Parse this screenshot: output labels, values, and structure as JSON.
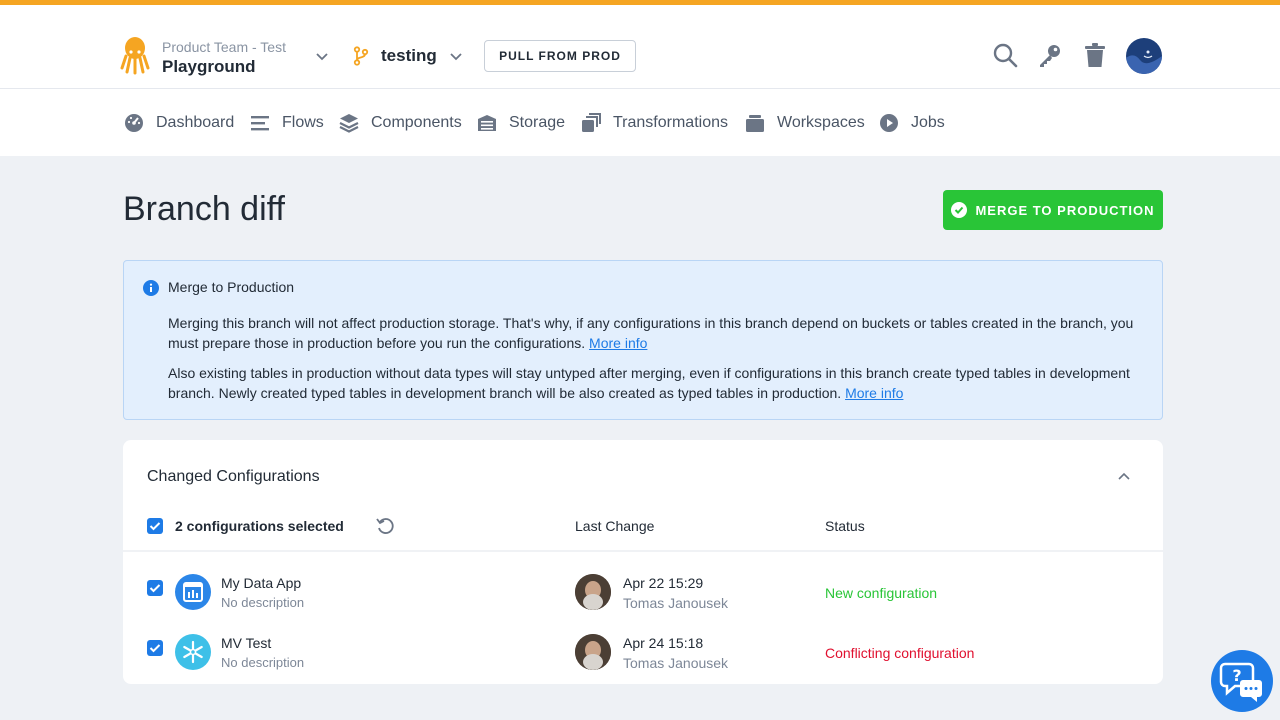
{
  "colors": {
    "accent_bar": "#f5a522",
    "primary": "#1e7be6",
    "success": "#29c537",
    "danger": "#e0102f",
    "status_new": "#29c537",
    "status_conflict": "#e0102f"
  },
  "header": {
    "org": "Product Team - Test",
    "project": "Playground",
    "branch": "testing",
    "pull_button": "PULL FROM PROD",
    "icons": [
      "search-icon",
      "key-icon",
      "trash-icon"
    ]
  },
  "nav": {
    "items": [
      {
        "label": "Dashboard",
        "icon": "dashboard-icon"
      },
      {
        "label": "Flows",
        "icon": "flows-icon"
      },
      {
        "label": "Components",
        "icon": "components-icon"
      },
      {
        "label": "Storage",
        "icon": "storage-icon"
      },
      {
        "label": "Transformations",
        "icon": "transformations-icon"
      },
      {
        "label": "Workspaces",
        "icon": "workspaces-icon"
      },
      {
        "label": "Jobs",
        "icon": "jobs-icon"
      }
    ]
  },
  "page": {
    "title": "Branch diff",
    "merge_button": "MERGE TO PRODUCTION"
  },
  "info": {
    "title": "Merge to Production",
    "p1": "Merging this branch will not affect production storage. That's why, if any configurations in this branch depend on buckets or tables created in the branch, you must prepare those in production before you run the configurations.",
    "p1_link": "More info",
    "p2": "Also existing tables in production without data types will stay untyped after merging, even if configurations in this branch create typed tables in development branch. Newly created typed tables in development branch will be also created as typed tables in production.",
    "p2_link": "More info"
  },
  "changes": {
    "title": "Changed Configurations",
    "selected_label": "2 configurations selected",
    "col_last_change": "Last Change",
    "col_status": "Status",
    "rows": [
      {
        "name": "My Data App",
        "description": "No description",
        "date": "Apr 22 15:29",
        "user": "Tomas Janousek",
        "status": "New configuration",
        "icon": "data-app-icon",
        "checked": true
      },
      {
        "name": "MV Test",
        "description": "No description",
        "date": "Apr 24 15:18",
        "user": "Tomas Janousek",
        "status": "Conflicting configuration",
        "icon": "snowflake-icon",
        "checked": true
      }
    ]
  },
  "help": {
    "icon": "help-chat-icon"
  }
}
